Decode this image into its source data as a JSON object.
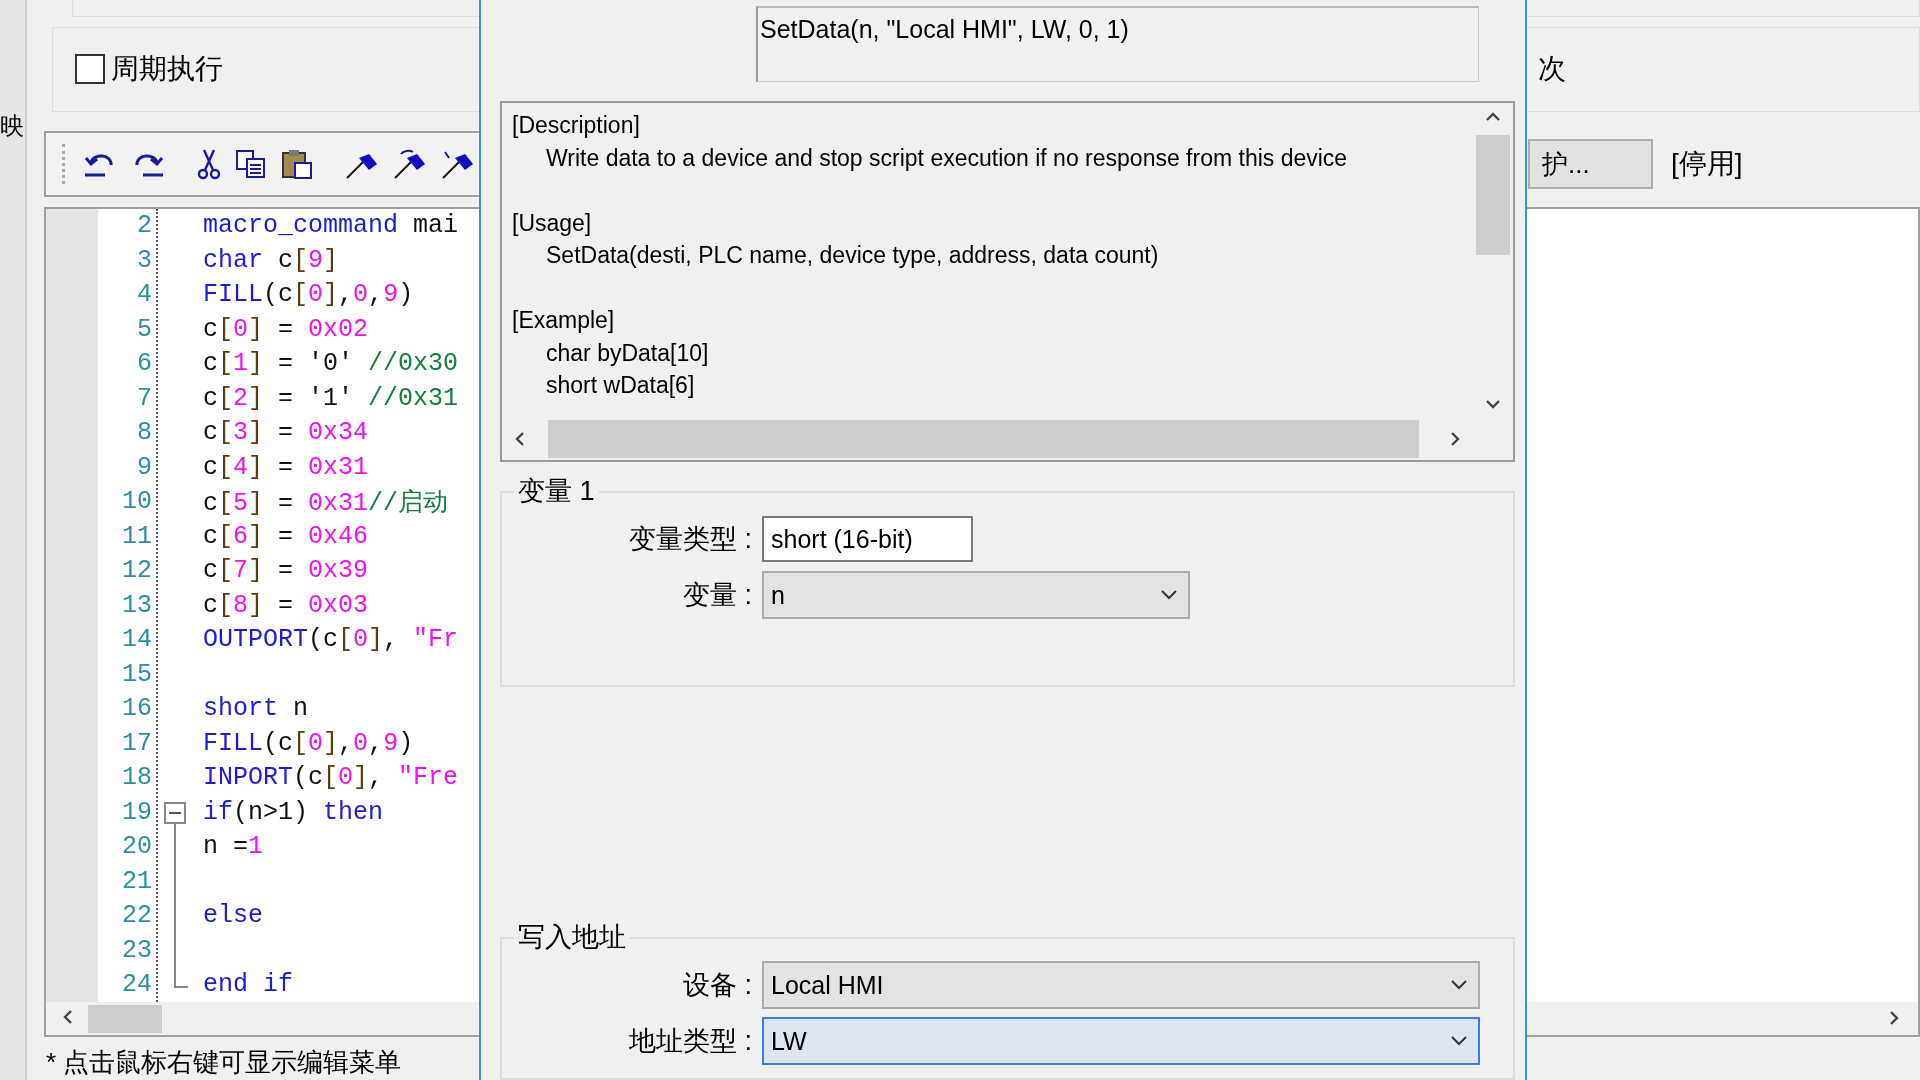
{
  "left_strip": {
    "label": "映"
  },
  "periodic": {
    "label": "周期执行",
    "checked": false
  },
  "side_text": "次",
  "protect_button": {
    "label": "护..."
  },
  "status": "[停用]",
  "editor": {
    "lines": [
      {
        "number": "2",
        "tokens": [
          {
            "kind": "kw",
            "text": "macro_command"
          },
          {
            "kind": "plain",
            "text": " mai"
          }
        ]
      },
      {
        "number": "3",
        "tokens": [
          {
            "kind": "kw",
            "text": "char"
          },
          {
            "kind": "plain",
            "text": " c"
          },
          {
            "kind": "br",
            "text": "["
          },
          {
            "kind": "num",
            "text": "9"
          },
          {
            "kind": "br",
            "text": "]"
          }
        ]
      },
      {
        "number": "4",
        "tokens": [
          {
            "kind": "kw",
            "text": "FILL"
          },
          {
            "kind": "plain",
            "text": "(c"
          },
          {
            "kind": "br",
            "text": "["
          },
          {
            "kind": "num",
            "text": "0"
          },
          {
            "kind": "br",
            "text": "]"
          },
          {
            "kind": "plain",
            "text": ","
          },
          {
            "kind": "num",
            "text": "0"
          },
          {
            "kind": "plain",
            "text": ","
          },
          {
            "kind": "num",
            "text": "9"
          },
          {
            "kind": "plain",
            "text": ")"
          }
        ]
      },
      {
        "number": "5",
        "tokens": [
          {
            "kind": "plain",
            "text": "c"
          },
          {
            "kind": "br",
            "text": "["
          },
          {
            "kind": "num",
            "text": "0"
          },
          {
            "kind": "br",
            "text": "]"
          },
          {
            "kind": "plain",
            "text": " = "
          },
          {
            "kind": "num",
            "text": "0x02"
          }
        ]
      },
      {
        "number": "6",
        "tokens": [
          {
            "kind": "plain",
            "text": "c"
          },
          {
            "kind": "br",
            "text": "["
          },
          {
            "kind": "num",
            "text": "1"
          },
          {
            "kind": "br",
            "text": "]"
          },
          {
            "kind": "plain",
            "text": " = '0' "
          },
          {
            "kind": "cm",
            "text": "//0x30"
          }
        ]
      },
      {
        "number": "7",
        "tokens": [
          {
            "kind": "plain",
            "text": "c"
          },
          {
            "kind": "br",
            "text": "["
          },
          {
            "kind": "num",
            "text": "2"
          },
          {
            "kind": "br",
            "text": "]"
          },
          {
            "kind": "plain",
            "text": " = '1' "
          },
          {
            "kind": "cm",
            "text": "//0x31"
          }
        ]
      },
      {
        "number": "8",
        "tokens": [
          {
            "kind": "plain",
            "text": "c"
          },
          {
            "kind": "br",
            "text": "["
          },
          {
            "kind": "num",
            "text": "3"
          },
          {
            "kind": "br",
            "text": "]"
          },
          {
            "kind": "plain",
            "text": " = "
          },
          {
            "kind": "num",
            "text": "0x34"
          }
        ]
      },
      {
        "number": "9",
        "tokens": [
          {
            "kind": "plain",
            "text": "c"
          },
          {
            "kind": "br",
            "text": "["
          },
          {
            "kind": "num",
            "text": "4"
          },
          {
            "kind": "br",
            "text": "]"
          },
          {
            "kind": "plain",
            "text": " = "
          },
          {
            "kind": "num",
            "text": "0x31"
          }
        ]
      },
      {
        "number": "10",
        "tokens": [
          {
            "kind": "plain",
            "text": "c"
          },
          {
            "kind": "br",
            "text": "["
          },
          {
            "kind": "num",
            "text": "5"
          },
          {
            "kind": "br",
            "text": "]"
          },
          {
            "kind": "plain",
            "text": " = "
          },
          {
            "kind": "num",
            "text": "0x31"
          },
          {
            "kind": "cm",
            "text": "//启动"
          }
        ]
      },
      {
        "number": "11",
        "tokens": [
          {
            "kind": "plain",
            "text": "c"
          },
          {
            "kind": "br",
            "text": "["
          },
          {
            "kind": "num",
            "text": "6"
          },
          {
            "kind": "br",
            "text": "]"
          },
          {
            "kind": "plain",
            "text": " = "
          },
          {
            "kind": "num",
            "text": "0x46"
          }
        ]
      },
      {
        "number": "12",
        "tokens": [
          {
            "kind": "plain",
            "text": "c"
          },
          {
            "kind": "br",
            "text": "["
          },
          {
            "kind": "num",
            "text": "7"
          },
          {
            "kind": "br",
            "text": "]"
          },
          {
            "kind": "plain",
            "text": " = "
          },
          {
            "kind": "num",
            "text": "0x39"
          }
        ]
      },
      {
        "number": "13",
        "tokens": [
          {
            "kind": "plain",
            "text": "c"
          },
          {
            "kind": "br",
            "text": "["
          },
          {
            "kind": "num",
            "text": "8"
          },
          {
            "kind": "br",
            "text": "]"
          },
          {
            "kind": "plain",
            "text": " = "
          },
          {
            "kind": "num",
            "text": "0x03"
          }
        ]
      },
      {
        "number": "14",
        "tokens": [
          {
            "kind": "kw",
            "text": "OUTPORT"
          },
          {
            "kind": "plain",
            "text": "(c"
          },
          {
            "kind": "br",
            "text": "["
          },
          {
            "kind": "num",
            "text": "0"
          },
          {
            "kind": "br",
            "text": "]"
          },
          {
            "kind": "plain",
            "text": ", "
          },
          {
            "kind": "str",
            "text": "\"Fr"
          }
        ]
      },
      {
        "number": "15"
      },
      {
        "number": "16",
        "tokens": [
          {
            "kind": "kw",
            "text": "short"
          },
          {
            "kind": "plain",
            "text": " n"
          }
        ]
      },
      {
        "number": "17",
        "tokens": [
          {
            "kind": "kw",
            "text": "FILL"
          },
          {
            "kind": "plain",
            "text": "(c"
          },
          {
            "kind": "br",
            "text": "["
          },
          {
            "kind": "num",
            "text": "0"
          },
          {
            "kind": "br",
            "text": "]"
          },
          {
            "kind": "plain",
            "text": ","
          },
          {
            "kind": "num",
            "text": "0"
          },
          {
            "kind": "plain",
            "text": ","
          },
          {
            "kind": "num",
            "text": "9"
          },
          {
            "kind": "plain",
            "text": ")"
          }
        ]
      },
      {
        "number": "18",
        "tokens": [
          {
            "kind": "kw",
            "text": "INPORT"
          },
          {
            "kind": "plain",
            "text": "(c"
          },
          {
            "kind": "br",
            "text": "["
          },
          {
            "kind": "num",
            "text": "0"
          },
          {
            "kind": "br",
            "text": "]"
          },
          {
            "kind": "plain",
            "text": ", "
          },
          {
            "kind": "str",
            "text": "\"Fre"
          }
        ]
      },
      {
        "number": "19",
        "kind": "fold-start",
        "expanded": true,
        "tokens": [
          {
            "kind": "kw",
            "text": "if"
          },
          {
            "kind": "plain",
            "text": "(n>1) "
          },
          {
            "kind": "kw",
            "text": "then"
          }
        ]
      },
      {
        "number": "20",
        "kind": "fold-inside",
        "tokens": [
          {
            "kind": "plain",
            "text": "n ="
          },
          {
            "kind": "num",
            "text": "1"
          }
        ]
      },
      {
        "number": "21",
        "kind": "fold-inside"
      },
      {
        "number": "22",
        "kind": "fold-inside",
        "tokens": [
          {
            "kind": "kw",
            "text": "else"
          }
        ]
      },
      {
        "number": "23",
        "kind": "fold-inside"
      },
      {
        "number": "24",
        "kind": "fold-end",
        "tokens": [
          {
            "kind": "kw",
            "text": "end if"
          }
        ]
      }
    ]
  },
  "hint": "* 点击鼠标右键可显示编辑菜单",
  "dialog": {
    "preview": "SetData(n, \"Local HMI\", LW, 0, 1)",
    "help": [
      {
        "heading": "[Description]",
        "lines": [
          "Write data to a device and stop script execution if no response from this device"
        ]
      },
      {
        "heading": "[Usage]",
        "lines": [
          "SetData(desti, PLC name, device type, address, data count)"
        ]
      },
      {
        "heading": "[Example]",
        "lines": [
          "char byData[10]",
          "short wData[6]"
        ]
      }
    ],
    "groups": [
      {
        "title": "变量 1",
        "fields": [
          {
            "label": "变量类型 :",
            "kind": "text",
            "value": "short (16-bit)",
            "focused": false
          },
          {
            "label": "变量 :",
            "kind": "combo",
            "value": "n",
            "focused": false
          }
        ]
      },
      {
        "title": "写入地址",
        "fields": [
          {
            "label": "设备 :",
            "kind": "combo",
            "value": "Local HMI",
            "focused": false
          },
          {
            "label": "地址类型 :",
            "kind": "combo",
            "value": "LW",
            "focused": true
          }
        ]
      }
    ]
  }
}
